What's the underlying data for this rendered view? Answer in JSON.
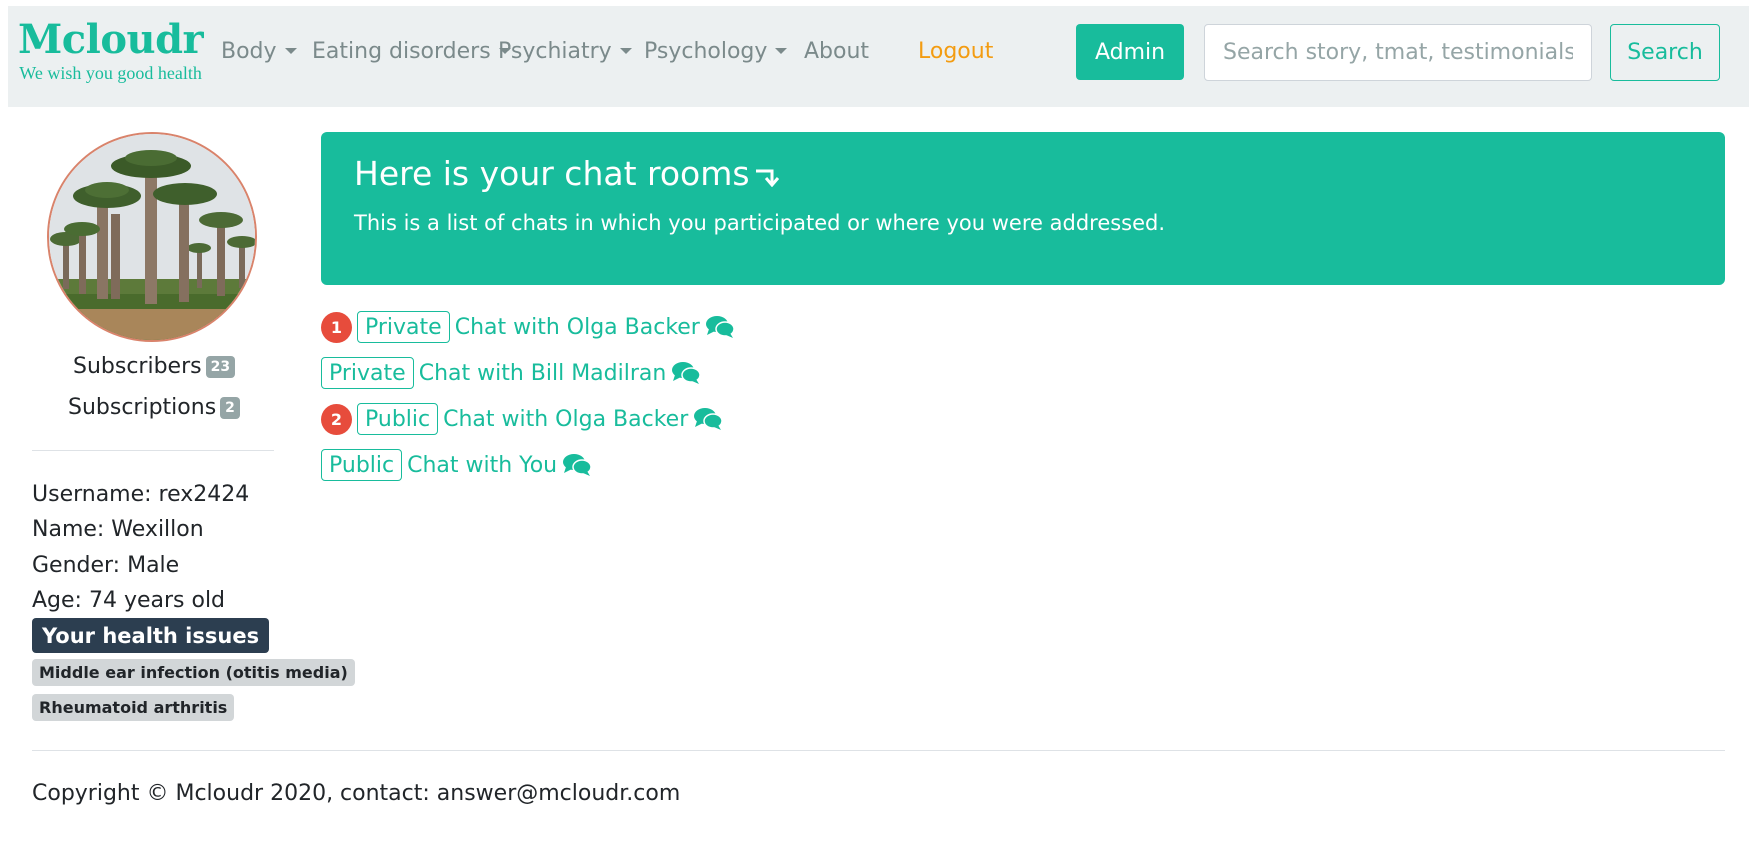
{
  "brand": {
    "name": "Mcloudr",
    "tagline": "We wish you good health"
  },
  "nav": {
    "items": [
      {
        "label": "Body",
        "dropdown": true
      },
      {
        "label": "Eating disorders",
        "dropdown": true
      },
      {
        "label": "Psychiatry",
        "dropdown": true
      },
      {
        "label": "Psychology",
        "dropdown": true
      },
      {
        "label": "About",
        "dropdown": false
      },
      {
        "label": "Logout",
        "dropdown": false
      }
    ],
    "admin_label": "Admin",
    "search_placeholder": "Search story, tmat, testimonials",
    "search_value": "",
    "search_button": "Search"
  },
  "sidebar": {
    "avatar_icon": "baobab-trees-photo",
    "subscribers_label": "Subscribers",
    "subscribers_count": "23",
    "subscriptions_label": "Subscriptions",
    "subscriptions_count": "2",
    "username": "Username: rex2424",
    "name": "Name: Wexillon",
    "gender": "Gender: Male",
    "age": "Age: 74 years old",
    "health_title": "Your health issues",
    "issues": [
      "Middle ear infection (otitis media)",
      "Rheumatoid arthritis"
    ]
  },
  "main": {
    "jumbo_title": "Here is your chat rooms",
    "jumbo_text": "This is a list of chats in which you participated or where you were addressed.",
    "chats": [
      {
        "unread": "1",
        "type": "Private",
        "title": "Chat with Olga Backer"
      },
      {
        "unread": "",
        "type": "Private",
        "title": "Chat with Bill Madilran"
      },
      {
        "unread": "2",
        "type": "Public",
        "title": "Chat with Olga Backer"
      },
      {
        "unread": "",
        "type": "Public",
        "title": "Chat with You"
      }
    ]
  },
  "footer": {
    "text": "Copyright © Mcloudr 2020, contact: answer@mcloudr.com"
  },
  "colors": {
    "primary": "#18bc9c",
    "dark": "#2c3e50",
    "danger": "#e74c3c",
    "warning": "#f39c12",
    "navbar": "#ecf0f1",
    "muted": "#95a5a6"
  }
}
